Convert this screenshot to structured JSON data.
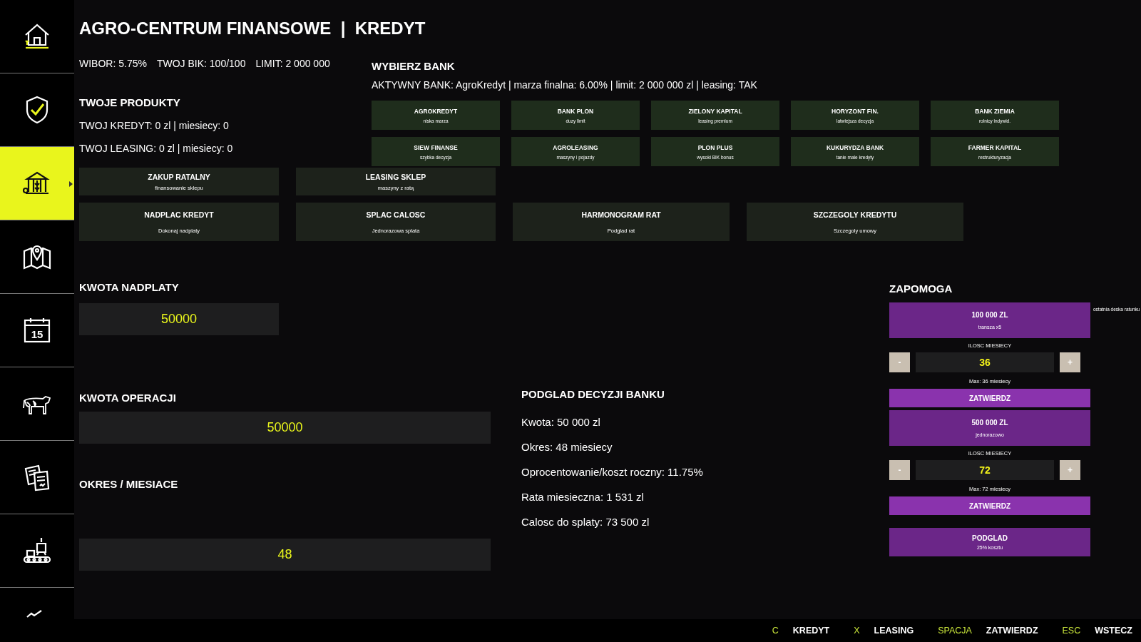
{
  "sidebar": {
    "items": [
      {
        "kind": "farm",
        "selected": false
      },
      {
        "kind": "shield",
        "selected": false
      },
      {
        "kind": "bank",
        "selected": true
      },
      {
        "kind": "map",
        "selected": false
      },
      {
        "kind": "calendar",
        "badge": "15",
        "selected": false
      },
      {
        "kind": "cow",
        "selected": false
      },
      {
        "kind": "documents",
        "selected": false
      },
      {
        "kind": "factory",
        "selected": false
      },
      {
        "kind": "partial",
        "selected": false
      }
    ]
  },
  "header": {
    "title": "AGRO-CENTRUM FINANSOWE  |  KREDYT"
  },
  "stats": [
    "WIBOR: 5.75%",
    "TWOJ BIK: 100/100",
    "LIMIT: 2 000 000"
  ],
  "products": {
    "title": "TWOJE PRODUKTY",
    "lines": [
      "TWOJ KREDYT: 0 zl | miesiecy: 0",
      "TWOJ LEASING: 0 zl | miesiecy: 0"
    ]
  },
  "bank_select": {
    "title": "WYBIERZ BANK",
    "active_line": "AKTYWNY BANK: AgroKredyt | marza finalna: 6.00% | limit: 2 000 000 zl | leasing: TAK",
    "banks": [
      {
        "name": "AGROKREDYT",
        "subtitle": "niska marza"
      },
      {
        "name": "BANK PLON",
        "subtitle": "duzy limit"
      },
      {
        "name": "ZIELONY KAPITAL",
        "subtitle": "leasing premium"
      },
      {
        "name": "HORYZONT FIN.",
        "subtitle": "latwiejsza decyzja"
      },
      {
        "name": "BANK ZIEMIA",
        "subtitle": "rolnicy indywid."
      },
      {
        "name": "SIEW FINANSE",
        "subtitle": "szybka decyzja"
      },
      {
        "name": "AGROLEASING",
        "subtitle": "maszyny i pojazdy"
      },
      {
        "name": "PLON PLUS",
        "subtitle": "wysoki BIK bonus"
      },
      {
        "name": "KUKURYDZA BANK",
        "subtitle": "tanie male kredyty"
      },
      {
        "name": "FARMER KAPITAL",
        "subtitle": "restrukturyzacja"
      }
    ]
  },
  "action_rows": [
    {
      "buttons": [
        {
          "label": "ZAKUP RATALNY",
          "sub": "finansowanie sklepu"
        },
        {
          "label": "LEASING SKLEP",
          "sub": "maszyny z ratą"
        }
      ]
    },
    {
      "buttons": [
        {
          "label": "NADPLAC KREDYT",
          "sub": "Dokonaj nadplaty"
        },
        {
          "label": "SPLAC CALOSC",
          "sub": "Jednorazowa splata"
        },
        {
          "label": "HARMONOGRAM RAT",
          "sub": "Podglad rat"
        },
        {
          "label": "SZCZEGOLY KREDYTU",
          "sub": "Szczegoly umowy"
        }
      ]
    }
  ],
  "overpayment": {
    "label": "KWOTA NADPLATY",
    "value": "50000"
  },
  "operation": {
    "label": "KWOTA OPERACJI",
    "value": "50000"
  },
  "period": {
    "label": "OKRES / MIESIACE",
    "value": "48"
  },
  "decision": {
    "title": "PODGLAD DECYZJI BANKU",
    "lines": [
      "Kwota: 50 000 zl",
      "Okres: 48 miesiecy",
      "Oprocentowanie/koszt roczny: 11.75%",
      "Rata miesieczna: 1 531 zl",
      "Calosc do splaty: 73 500 zl"
    ]
  },
  "aid": {
    "title": "ZAPOMOGA",
    "note": "ostatnia deska ratunku",
    "offers": [
      {
        "amount": "100 000 ZL",
        "sub": "transza x5",
        "counter_label": "ILOSC MIESIECY",
        "minus": "-",
        "value": "36",
        "plus": "+",
        "max": "Max: 36 miesiecy",
        "confirm": "ZATWIERDZ"
      },
      {
        "amount": "500 000 ZL",
        "sub": "jednorazowo",
        "counter_label": "ILOSC MIESIECY",
        "minus": "-",
        "value": "72",
        "plus": "+",
        "max": "Max: 72 miesiecy",
        "confirm": "ZATWIERDZ"
      }
    ],
    "preview": {
      "label": "PODGLAD",
      "sub": "25% kosztu"
    }
  },
  "footer": {
    "hints": [
      {
        "key": "C",
        "label": "KREDYT"
      },
      {
        "key": "X",
        "label": "LEASING"
      },
      {
        "key": "SPACJA",
        "label": "ZATWIERDZ"
      },
      {
        "key": "ESC",
        "label": "WSTECZ"
      }
    ]
  }
}
